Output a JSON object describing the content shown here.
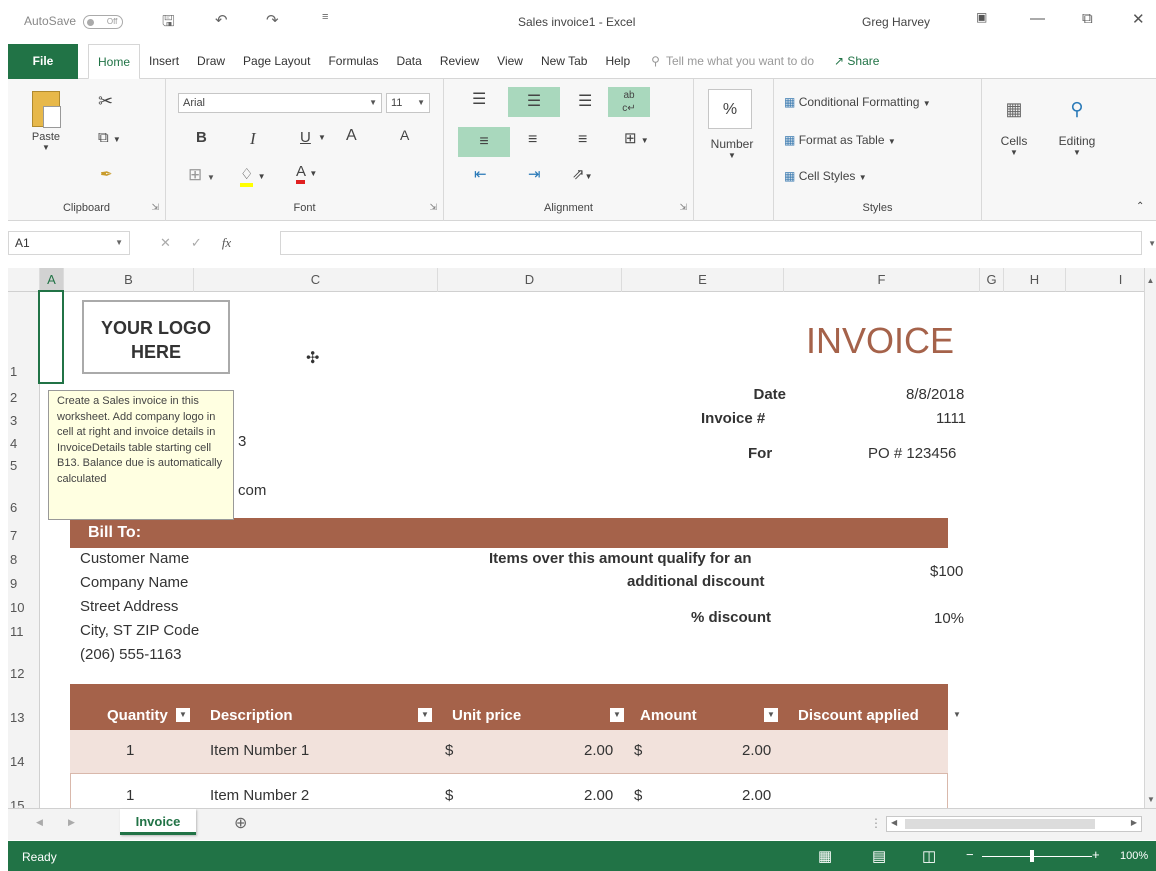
{
  "titlebar": {
    "autosave_label": "AutoSave",
    "autosave_state": "Off",
    "doc_title": "Sales invoice1 - Excel",
    "user": "Greg Harvey"
  },
  "tabs": [
    "File",
    "Home",
    "Insert",
    "Draw",
    "Page Layout",
    "Formulas",
    "Data",
    "Review",
    "View",
    "New Tab",
    "Help"
  ],
  "active_tab": "Home",
  "tell_me": "Tell me what you want to do",
  "share": "Share",
  "ribbon": {
    "clipboard": {
      "label": "Clipboard",
      "paste": "Paste"
    },
    "font": {
      "label": "Font",
      "font_name": "Arial",
      "font_size": "11",
      "bold": "B",
      "italic": "I",
      "underline": "U",
      "grow": "A",
      "shrink": "A",
      "font_color": "A"
    },
    "alignment": {
      "label": "Alignment"
    },
    "number": {
      "label": "Number",
      "symbol": "%"
    },
    "styles": {
      "label": "Styles",
      "conditional": "Conditional Formatting",
      "format_table": "Format as Table",
      "cell_styles": "Cell Styles"
    },
    "cells": {
      "label": "Cells"
    },
    "editing": {
      "label": "Editing"
    }
  },
  "formula_bar": {
    "name_box": "A1",
    "fx": "fx",
    "value": ""
  },
  "columns": [
    "A",
    "B",
    "C",
    "D",
    "E",
    "F",
    "G",
    "H",
    "I"
  ],
  "rows": [
    "1",
    "2",
    "3",
    "4",
    "5",
    "6",
    "7",
    "8",
    "9",
    "10",
    "11",
    "12",
    "13",
    "14",
    "15"
  ],
  "invoice": {
    "logo": "YOUR LOGO HERE",
    "title": "INVOICE",
    "date_label": "Date",
    "date_value": "8/8/2018",
    "invoice_label": "Invoice #",
    "invoice_value": "1111",
    "for_label": "For",
    "for_value": "PO # 123456",
    "partial_phone": "3",
    "partial_email": "com",
    "bill_to": "Bill To:",
    "customer": [
      "Customer Name",
      "Company Name",
      "Street Address",
      "City, ST  ZIP Code",
      "(206) 555-1163"
    ],
    "discount_note_1": "Items over this amount qualify for an",
    "discount_note_2": "additional discount",
    "threshold": "$100",
    "pct_label": "% discount",
    "pct_value": "10%",
    "table_headers": [
      "Quantity",
      "Description",
      "Unit price",
      "Amount",
      "Discount applied"
    ],
    "items": [
      {
        "qty": "1",
        "desc": "Item Number 1",
        "cur1": "$",
        "unit": "2.00",
        "cur2": "$",
        "amount": "2.00"
      },
      {
        "qty": "1",
        "desc": "Item Number 2",
        "cur1": "$",
        "unit": "2.00",
        "cur2": "$",
        "amount": "2.00"
      }
    ]
  },
  "tooltip": "Create a Sales invoice in this worksheet. Add company logo in cell at right and invoice details in InvoiceDetails table starting cell B13. Balance due is automatically calculated",
  "sheet_tab": "Invoice",
  "status": {
    "ready": "Ready",
    "zoom": "100%"
  }
}
